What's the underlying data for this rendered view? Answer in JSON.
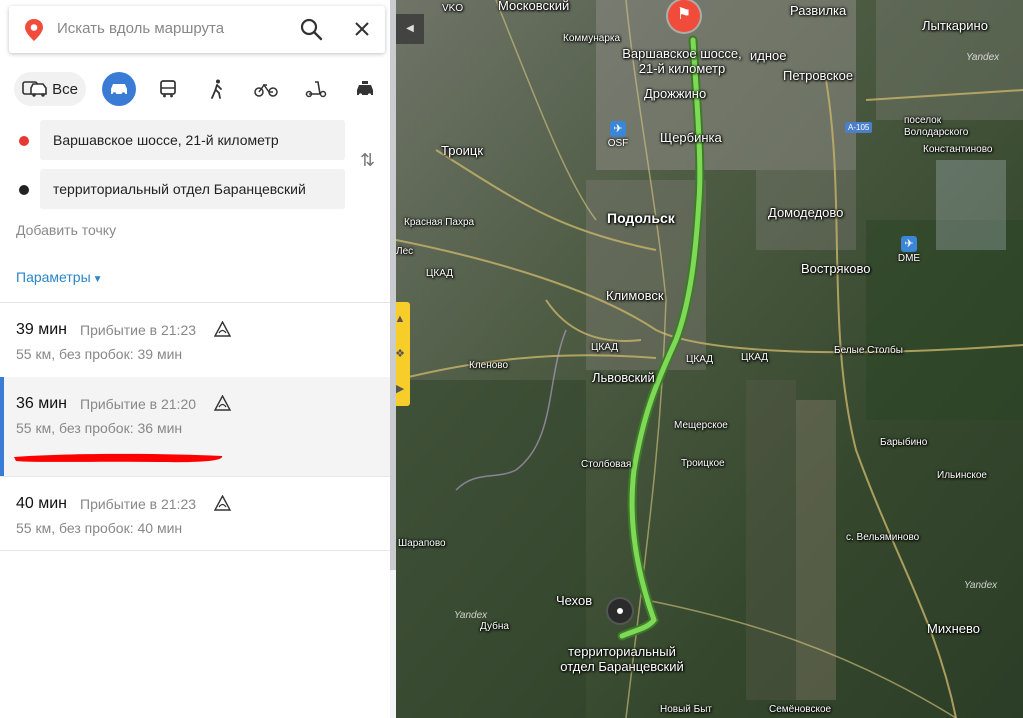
{
  "search": {
    "placeholder": "Искать вдоль маршрута"
  },
  "modes": {
    "all_label": "Все",
    "items": [
      "car-icon",
      "bus-icon",
      "walk-icon",
      "bike-icon",
      "scooter-icon",
      "taxi-icon"
    ],
    "active": "car"
  },
  "route_points": {
    "from": "Варшавское шоссе, 21-й километр",
    "to": "территориальный отдел Баранцевский",
    "add_point": "Добавить точку"
  },
  "params_label": "Параметры",
  "routes": [
    {
      "time": "39 мин",
      "arrival": "Прибытие в 21:23",
      "details": "55 км, без пробок: 39 мин",
      "selected": false
    },
    {
      "time": "36 мин",
      "arrival": "Прибытие в 21:20",
      "details": "55 км, без пробок: 36 мин",
      "selected": true
    },
    {
      "time": "40 мин",
      "arrival": "Прибытие в 21:23",
      "details": "55 км, без пробок: 40 мин",
      "selected": false
    }
  ],
  "colors": {
    "accent": "#3a7bd5",
    "route_line": "#7ed957",
    "start_pin": "#f14b3c",
    "params_link": "#2a86c9",
    "annotation": "#ff0000"
  },
  "map": {
    "start_label": [
      "Варшавское шоссе,",
      "21-й километр"
    ],
    "end_label": [
      "территориальный",
      "отдел Баранцевский"
    ],
    "places": {
      "moskovsky": "Московский",
      "vko": "VKO",
      "kommunarka": "Коммунарка",
      "razvilka": "Развилка",
      "lytkarino": "Лыткарино",
      "vidnoe_frag": "идное",
      "petrovskoe": "Петровское",
      "drozhzhino": "Дрожжино",
      "troitsk": "Троицк",
      "scherbinka": "Щербинка",
      "volodarsky": "поселок\nВолодарского",
      "konstantinovo": "Константиново",
      "krasnaya_pakhra": "Красная Пахра",
      "podolsk": "Подольск",
      "domodedovo": "Домодедово",
      "les": "Лес",
      "vostryakovo": "Востряково",
      "klimovsk": "Климовск",
      "belye_stolby": "Белые Столбы",
      "klenovo": "Кленово",
      "lvovsky": "Львовский",
      "mescherskoe": "Мещерское",
      "barybino": "Барыбино",
      "stolbovaya": "Столбовая",
      "troitskoe": "Троицкое",
      "ilinskoe": "Ильинское",
      "sharapovo": "Шарапово",
      "velyaminovo": "с. Вельяминово",
      "chekhov": "Чехов",
      "dubna": "Дубна",
      "mikhnevo": "Михнево",
      "novy_byt": "Новый Быт",
      "semenovskoe": "Семёновское"
    },
    "roads": {
      "a105": "A-105",
      "tskad1": "ЦКАД",
      "tskad2": "ЦКАД",
      "tskad3": "ЦКАД",
      "tskad4": "ЦКАД"
    },
    "airports": {
      "osf": "OSF",
      "dme": "DME"
    },
    "watermark": "Yandex"
  }
}
